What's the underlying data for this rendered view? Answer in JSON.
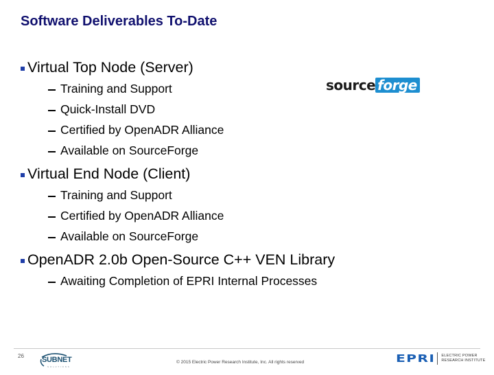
{
  "slide": {
    "title": "Software Deliverables To-Date",
    "page_number": "26",
    "items": [
      {
        "label": "Virtual Top Node (Server)",
        "subitems": [
          "Training and Support",
          "Quick-Install DVD",
          "Certified by OpenADR Alliance",
          "Available on SourceForge"
        ]
      },
      {
        "label": "Virtual End Node (Client)",
        "subitems": [
          "Training and Support",
          "Certified by OpenADR Alliance",
          "Available on SourceForge"
        ]
      },
      {
        "label": "OpenADR 2.0b Open-Source C++ VEN Library",
        "subitems": [
          "Awaiting Completion of EPRI Internal Processes"
        ]
      }
    ]
  },
  "logos": {
    "sourceforge": {
      "part1": "source",
      "part2": "forge"
    },
    "subnet": {
      "name": "SUBNET",
      "tagline": "S O L U T I O N S"
    },
    "epri": {
      "mark": "EPRI",
      "line1": "ELECTRIC POWER",
      "line2": "RESEARCH INSTITUTE"
    }
  },
  "footer": {
    "copyright": "© 2015 Electric Power Research Institute, Inc. All rights reserved"
  },
  "colors": {
    "title": "#10106e",
    "bullet": "#1f3ea8",
    "sourceforge_blue": "#1d8ed0",
    "epri_blue": "#1a5fb4"
  }
}
